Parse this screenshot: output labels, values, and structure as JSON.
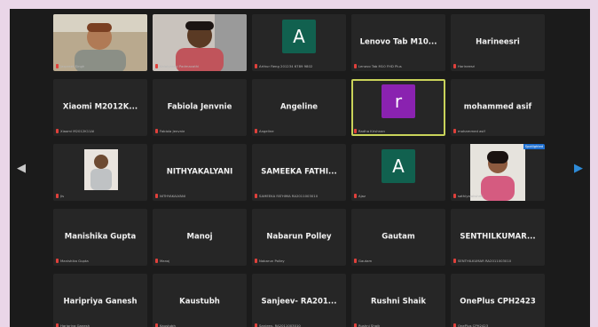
{
  "tiles": [
    {
      "type": "video",
      "name": "",
      "label": "Jaspreet Singh",
      "mic": "muted"
    },
    {
      "type": "video",
      "name": "",
      "label": "Kalaiyarasi Padmavathi",
      "mic": "muted"
    },
    {
      "type": "avatar",
      "name": "",
      "avatar_letter": "A",
      "avatar_color": "#11614f",
      "label": "Arthur Reng 201234 6789 9802",
      "mic": "muted"
    },
    {
      "type": "name",
      "name": "Lenovo Tab M10...",
      "label": "Lenovo Tab M10 FHD Plus",
      "mic": "muted"
    },
    {
      "type": "name",
      "name": "Harineesri",
      "label": "Harineesri",
      "mic": "muted"
    },
    {
      "type": "name",
      "name": "Xiaomi M2012K...",
      "label": "Xiaomi M2012K11AI",
      "mic": "muted"
    },
    {
      "type": "name",
      "name": "Fabiola Jenvnie",
      "label": "Fabiola Jenvnie",
      "mic": "muted"
    },
    {
      "type": "name",
      "name": "Angeline",
      "label": "Angeline",
      "mic": "muted"
    },
    {
      "type": "avatar",
      "name": "",
      "avatar_letter": "r",
      "avatar_color": "#8a22b0",
      "label": "Radha Krishnan",
      "mic": "muted",
      "active": true
    },
    {
      "type": "name",
      "name": "mohammed asif",
      "label": "mohammed asif",
      "mic": "muted"
    },
    {
      "type": "photo",
      "name": "",
      "label": "Jis",
      "mic": "muted"
    },
    {
      "type": "name",
      "name": "NITHYAKALYANI",
      "label": "NITHYAKALYANI",
      "mic": "muted"
    },
    {
      "type": "name",
      "name": "SAMEEKA FATHI...",
      "label": "SAMEEKA FATHIMA RA2011003010",
      "mic": "muted"
    },
    {
      "type": "avatar",
      "name": "",
      "avatar_letter": "A",
      "avatar_color": "#11614f",
      "label": "Ajaz",
      "mic": "muted"
    },
    {
      "type": "video-woman",
      "name": "",
      "label": "sathiyalakshmi",
      "mic": "muted",
      "badge": "Spotlighted"
    },
    {
      "type": "name",
      "name": "Manishika Gupta",
      "label": "Manishika Gupta",
      "mic": "muted"
    },
    {
      "type": "name",
      "name": "Manoj",
      "label": "Manoj",
      "mic": "muted"
    },
    {
      "type": "name",
      "name": "Nabarun Polley",
      "label": "Nabarun Polley",
      "mic": "muted"
    },
    {
      "type": "name",
      "name": "Gautam",
      "label": "Gautam",
      "mic": "muted"
    },
    {
      "type": "name",
      "name": "SENTHILKUMAR...",
      "label": "SENTHILKUMAR RA2011003010",
      "mic": "muted"
    },
    {
      "type": "name",
      "name": "Haripriya Ganesh",
      "label": "Haripriya Ganesh",
      "mic": "muted"
    },
    {
      "type": "name",
      "name": "Kaustubh",
      "label": "Kaustubh",
      "mic": "muted"
    },
    {
      "type": "name",
      "name": "Sanjeev- RA201...",
      "label": "Sanjeev- RA2011003010",
      "mic": "muted"
    },
    {
      "type": "name",
      "name": "Rushni Shaik",
      "label": "Rushni Shaik",
      "mic": "muted"
    },
    {
      "type": "name",
      "name": "OnePlus CPH2423",
      "label": "OnePlus CPH2423",
      "mic": "muted"
    }
  ],
  "navigation": {
    "prev_icon": "chevron-left-icon",
    "next_icon": "chevron-right-icon"
  },
  "colors": {
    "background": "#1b1b1b",
    "tile": "#262626",
    "active_border": "#c9d35a",
    "muted_mic": "#e0403b",
    "next_arrow": "#2e8bd8"
  }
}
